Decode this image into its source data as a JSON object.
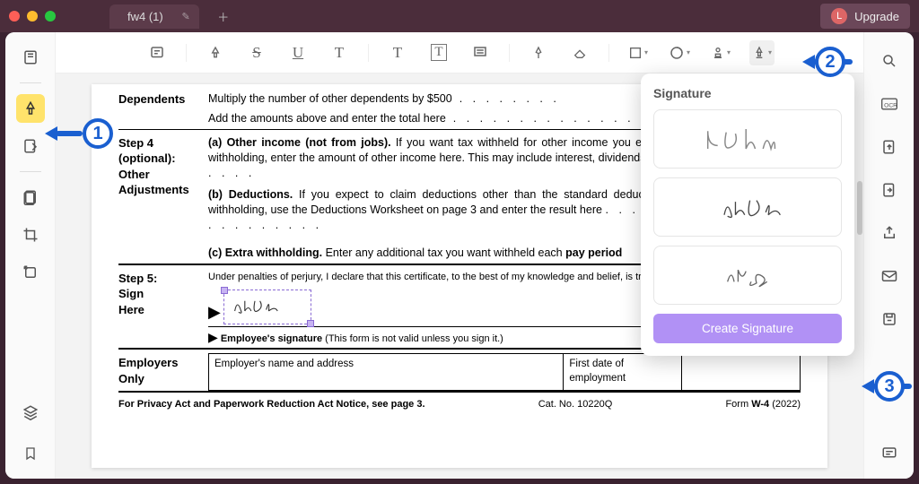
{
  "titlebar": {
    "tab_name": "fw4 (1)",
    "upgrade": "Upgrade",
    "avatar_letter": "L"
  },
  "annotations": {
    "n1": "1",
    "n2": "2",
    "n3": "3"
  },
  "signature_panel": {
    "title": "Signature",
    "create": "Create Signature"
  },
  "doc": {
    "dependents_label": "Dependents",
    "dependents_line": "Multiply the number of other dependents by $500",
    "dependents_amt_marker": "▶  $",
    "add_amounts": "Add the amounts above and enter the total here",
    "step4_label1": "Step 4",
    "step4_label2": "(optional):",
    "step4_label3": "Other",
    "step4_label4": "Adjustments",
    "s4a_lead": "(a) Other income (not from jobs).",
    "s4a_rest": " If you want tax withheld for other income you expect this year that won't have withholding, enter the amount of other income here. This may include interest, dividends, and retirement income",
    "s4b_lead": "(b) Deductions.",
    "s4b_rest": " If you expect to claim deductions other than the standard deduction and want to reduce your withholding, use the Deductions Worksheet on page 3 and enter the result here",
    "s4c_lead": "(c) Extra withholding.",
    "s4c_rest": " Enter any additional tax you want withheld each ",
    "s4c_bold": "pay period",
    "step5_label1": "Step 5:",
    "step5_label2": "Sign",
    "step5_label3": "Here",
    "perjury": "Under penalties of perjury, I declare that this certificate, to the best of my knowledge and belief, is true, correct, and complete.",
    "emp_sig_label": "Employee's signature",
    "emp_sig_note": " (This form is not valid unless you sign it.)",
    "employers_label1": "Employers",
    "employers_label2": "Only",
    "emp_name_addr": "Employer's name and address",
    "first_date": "First date of employment",
    "footer_left": "For Privacy Act and Paperwork Reduction Act Notice, see page 3.",
    "footer_mid": "Cat. No. 10220Q",
    "footer_form": "W-4",
    "footer_formword": "Form ",
    "footer_year": " (2022)"
  }
}
